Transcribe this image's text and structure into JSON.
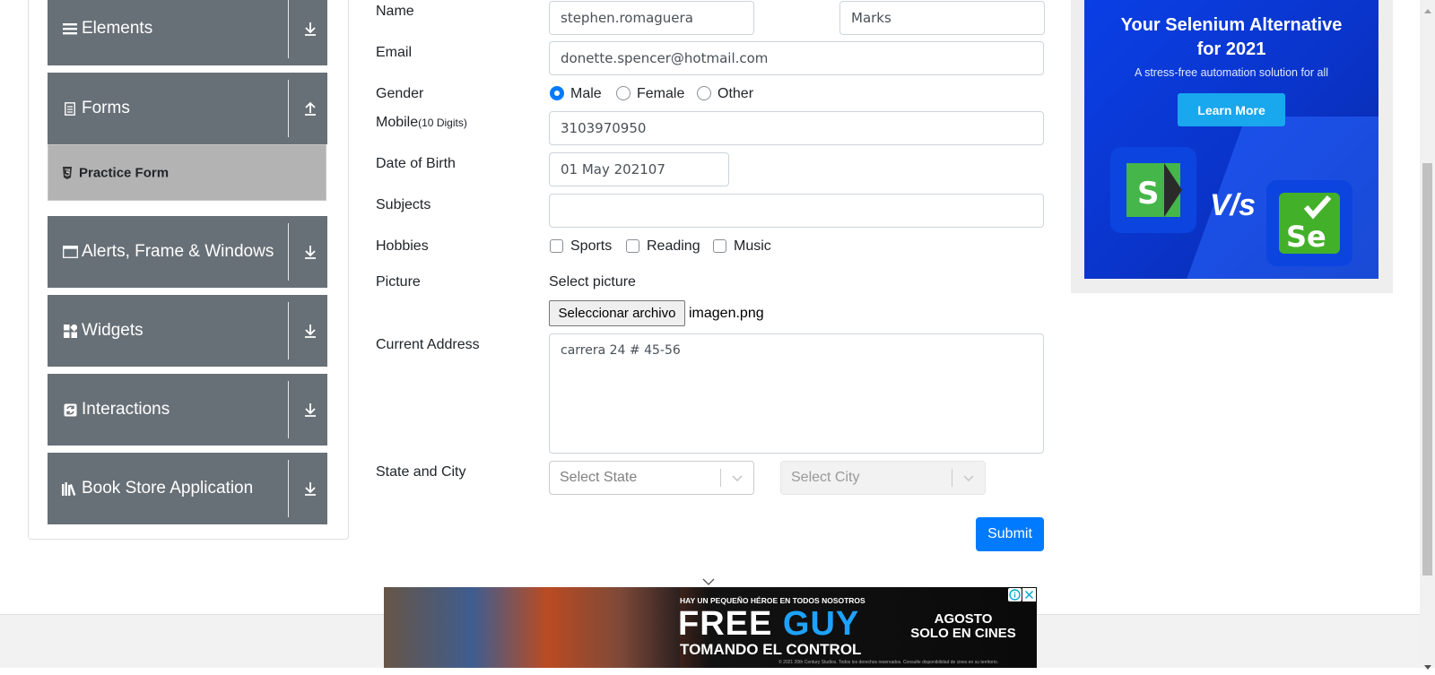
{
  "sidebar": {
    "groups": [
      {
        "label": "Elements",
        "icon": "menu-icon"
      },
      {
        "label": "Forms",
        "icon": "document-icon",
        "expanded": true
      },
      {
        "label": "Alerts, Frame & Windows",
        "icon": "window-icon"
      },
      {
        "label": "Widgets",
        "icon": "widgets-icon"
      },
      {
        "label": "Interactions",
        "icon": "interactions-icon"
      },
      {
        "label": "Book Store Application",
        "icon": "books-icon"
      }
    ],
    "active_item": "Practice Form"
  },
  "form": {
    "name_label": "Name",
    "first_name": "stephen.romaguera",
    "last_name": "Marks",
    "email_label": "Email",
    "email": "donette.spencer@hotmail.com",
    "gender_label": "Gender",
    "gender_options": [
      "Male",
      "Female",
      "Other"
    ],
    "gender_selected": "Male",
    "mobile_label": "Mobile",
    "mobile_hint": "(10 Digits)",
    "mobile": "3103970950",
    "dob_label": "Date of Birth",
    "dob": "01 May 202107",
    "subjects_label": "Subjects",
    "subjects": "",
    "hobbies_label": "Hobbies",
    "hobbies": [
      "Sports",
      "Reading",
      "Music"
    ],
    "picture_label": "Picture",
    "picture_prompt": "Select picture",
    "file_button": "Seleccionar archivo",
    "file_name": "imagen.png",
    "address_label": "Current Address",
    "address": "carrera 24 # 45-56",
    "state_city_label": "State and City",
    "state_placeholder": "Select State",
    "city_placeholder": "Select City",
    "submit": "Submit"
  },
  "ad_right": {
    "title_line1": "Your Selenium Alternative",
    "title_line2": "for 2021",
    "subtitle": "A stress-free automation solution for all",
    "cta": "Learn More",
    "vs": "V/s"
  },
  "ad_bottom": {
    "tagline": "HAY UN PEQUEÑO HÉROE EN TODOS NOSOTROS",
    "title_a": "FREE",
    "title_b": "GUY",
    "subtitle": "TOMANDO EL CONTROL",
    "date_line1": "AGOSTO",
    "date_line2": "SOLO EN CINES",
    "copyright": "© 2021 20th Century Studios. Todos los derechos reservados. Consulte disponibilidad de cines en su territorio."
  },
  "colors": {
    "sidebar_bg": "#687077",
    "active_item_bg": "#b3b3b3",
    "primary": "#007bff",
    "ad_blue": "#0a3fe6"
  }
}
